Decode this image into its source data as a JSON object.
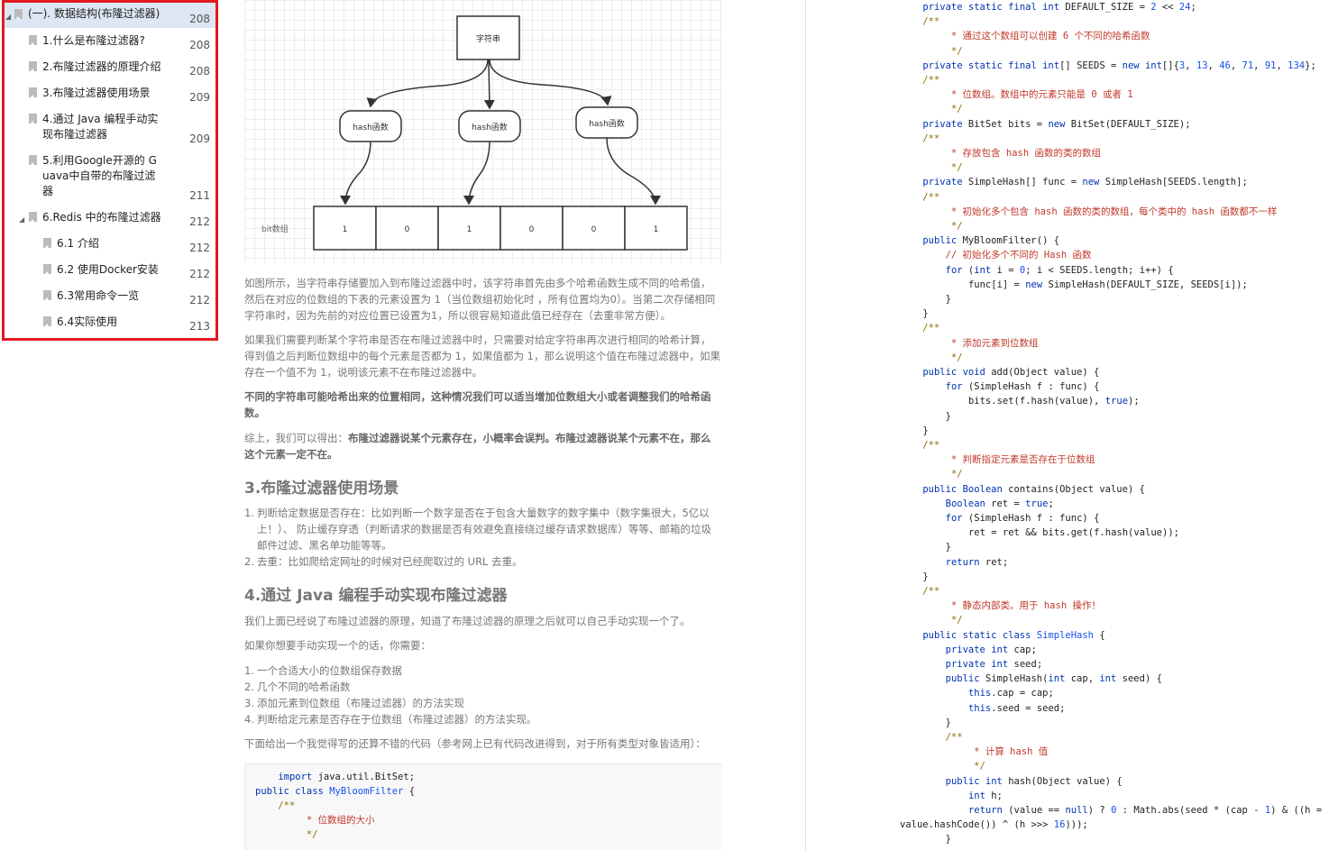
{
  "outline": {
    "items": [
      {
        "label": "(一). 数据结构(布隆过滤器)",
        "page": "208",
        "level": 0,
        "expanded": true,
        "active": true
      },
      {
        "label": "1.什么是布隆过滤器?",
        "page": "208",
        "level": 1
      },
      {
        "label": "2.布隆过滤器的原理介绍",
        "page": "208",
        "level": 1
      },
      {
        "label": "3.布隆过滤器使用场景",
        "page": "209",
        "level": 1
      },
      {
        "label": "4.通过 Java 编程手动实现布隆过滤器",
        "page": "209",
        "level": 1,
        "wrap": true
      },
      {
        "label": "5.利用Google开源的 Guava中自带的布隆过滤器",
        "page": "211",
        "level": 1,
        "wrap": true
      },
      {
        "label": "6.Redis 中的布隆过滤器",
        "page": "212",
        "level": 1,
        "expanded": true
      },
      {
        "label": "6.1 介绍",
        "page": "212",
        "level": 2
      },
      {
        "label": "6.2 使用Docker安装",
        "page": "212",
        "level": 2
      },
      {
        "label": "6.3常用命令一览",
        "page": "212",
        "level": 2
      },
      {
        "label": "6.4实际使用",
        "page": "213",
        "level": 2
      }
    ]
  },
  "diagram": {
    "input_label": "字符串",
    "hash_labels": [
      "hash函数",
      "hash函数",
      "hash函数"
    ],
    "array_label": "bit数组",
    "bits": [
      "1",
      "0",
      "1",
      "0",
      "0",
      "1"
    ]
  },
  "article": {
    "p1": "如图所示，当字符串存储要加入到布隆过滤器中时，该字符串首先由多个哈希函数生成不同的哈希值，然后在对应的位数组的下表的元素设置为 1（当位数组初始化时 ，所有位置均为0）。当第二次存储相同字符串时，因为先前的对应位置已设置为1，所以很容易知道此值已经存在（去重非常方便）。",
    "p2": "如果我们需要判断某个字符串是否在布隆过滤器中时，只需要对给定字符串再次进行相同的哈希计算，得到值之后判断位数组中的每个元素是否都为 1，如果值都为 1，那么说明这个值在布隆过滤器中，如果存在一个值不为 1，说明该元素不在布隆过滤器中。",
    "p3": "不同的字符串可能哈希出来的位置相同，这种情况我们可以适当增加位数组大小或者调整我们的哈希函数。",
    "p4_prefix": "综上，我们可以得出：",
    "p4_bold": "布隆过滤器说某个元素存在，小概率会误判。布隆过滤器说某个元素不在，那么这个元素一定不在。",
    "h_scenes": "3.布隆过滤器使用场景",
    "scenes": [
      "判断给定数据是否存在：比如判断一个数字是否在于包含大量数字的数字集中（数字集很大，5亿以上！）、 防止缓存穿透（判断请求的数据是否有效避免直接绕过缓存请求数据库）等等、邮箱的垃圾邮件过滤、黑名单功能等等。",
      "去重：比如爬给定网址的时候对已经爬取过的 URL 去重。"
    ],
    "h_java": "4.通过 Java 编程手动实现布隆过滤器",
    "p5": "我们上面已经说了布隆过滤器的原理，知道了布隆过滤器的原理之后就可以自己手动实现一个了。",
    "p6": "如果你想要手动实现一个的话，你需要：",
    "steps": [
      "一个合适大小的位数组保存数据",
      "几个不同的哈希函数",
      "添加元素到位数组（布隆过滤器）的方法实现",
      "判断给定元素是否存在于位数组（布隆过滤器）的方法实现。"
    ],
    "p7": "下面给出一个我觉得写的还算不错的代码（参考网上已有代码改进得到，对于所有类型对象皆适用）："
  },
  "code_left": [
    "    import java.util.BitSet;",
    "public class MyBloomFilter {",
    "    /**",
    "         * 位数组的大小",
    "         */"
  ],
  "code_right": [
    "    private static final int DEFAULT_SIZE = 2 << 24;",
    "    /**",
    "         * 通过这个数组可以创建 6 个不同的哈希函数",
    "         */",
    "    private static final int[] SEEDS = new int[]{3, 13, 46, 71, 91, 134};",
    "    /**",
    "         * 位数组。数组中的元素只能是 0 或者 1",
    "         */",
    "    private BitSet bits = new BitSet(DEFAULT_SIZE);",
    "    /**",
    "         * 存放包含 hash 函数的类的数组",
    "         */",
    "    private SimpleHash[] func = new SimpleHash[SEEDS.length];",
    "    /**",
    "         * 初始化多个包含 hash 函数的类的数组，每个类中的 hash 函数都不一样",
    "         */",
    "    public MyBloomFilter() {",
    "        // 初始化多个不同的 Hash 函数",
    "        for (int i = 0; i < SEEDS.length; i++) {",
    "            func[i] = new SimpleHash(DEFAULT_SIZE, SEEDS[i]);",
    "        }",
    "    }",
    "    /**",
    "         * 添加元素到位数组",
    "         */",
    "    public void add(Object value) {",
    "        for (SimpleHash f : func) {",
    "            bits.set(f.hash(value), true);",
    "        }",
    "    }",
    "    /**",
    "         * 判断指定元素是否存在于位数组",
    "         */",
    "    public Boolean contains(Object value) {",
    "        Boolean ret = true;",
    "        for (SimpleHash f : func) {",
    "            ret = ret && bits.get(f.hash(value));",
    "        }",
    "        return ret;",
    "    }",
    "    /**",
    "         * 静态内部类。用于 hash 操作！",
    "         */",
    "    public static class SimpleHash {",
    "        private int cap;",
    "        private int seed;",
    "        public SimpleHash(int cap, int seed) {",
    "            this.cap = cap;",
    "            this.seed = seed;",
    "        }",
    "        /**",
    "             * 计算 hash 值",
    "             */",
    "        public int hash(Object value) {",
    "            int h;",
    "            return (value == null) ? 0 : Math.abs(seed * (cap - 1) & ((h =",
    "value.hashCode()) ^ (h >>> 16)));",
    "        }"
  ]
}
